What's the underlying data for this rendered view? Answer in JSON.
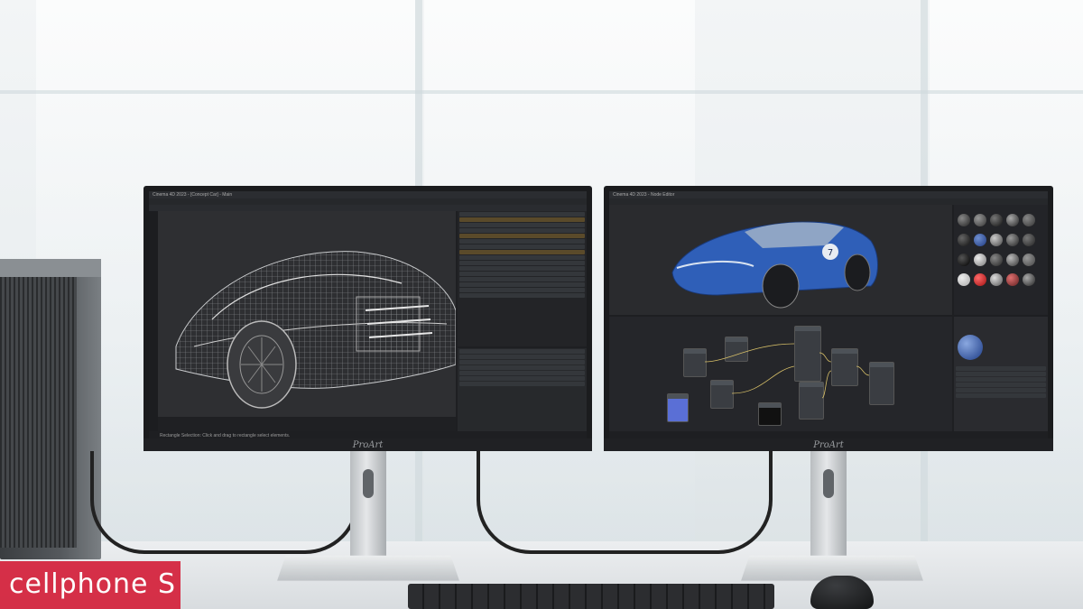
{
  "monitor_left": {
    "logo": "ProArt",
    "window_title": "Cinema 4D 2023 - [Concept Car] - Main",
    "status_text": "Rectangle Selection: Click and drag to rectangle select elements."
  },
  "monitor_right": {
    "logo": "ProArt",
    "window_title": "Cinema 4D 2023 - Node Editor",
    "car_number": "7"
  },
  "watermark": {
    "brand": "cellphone S"
  },
  "colors": {
    "car_blue": "#2f5fb8",
    "brand_red": "#d4203a",
    "ui_dark": "#1e1f22"
  }
}
